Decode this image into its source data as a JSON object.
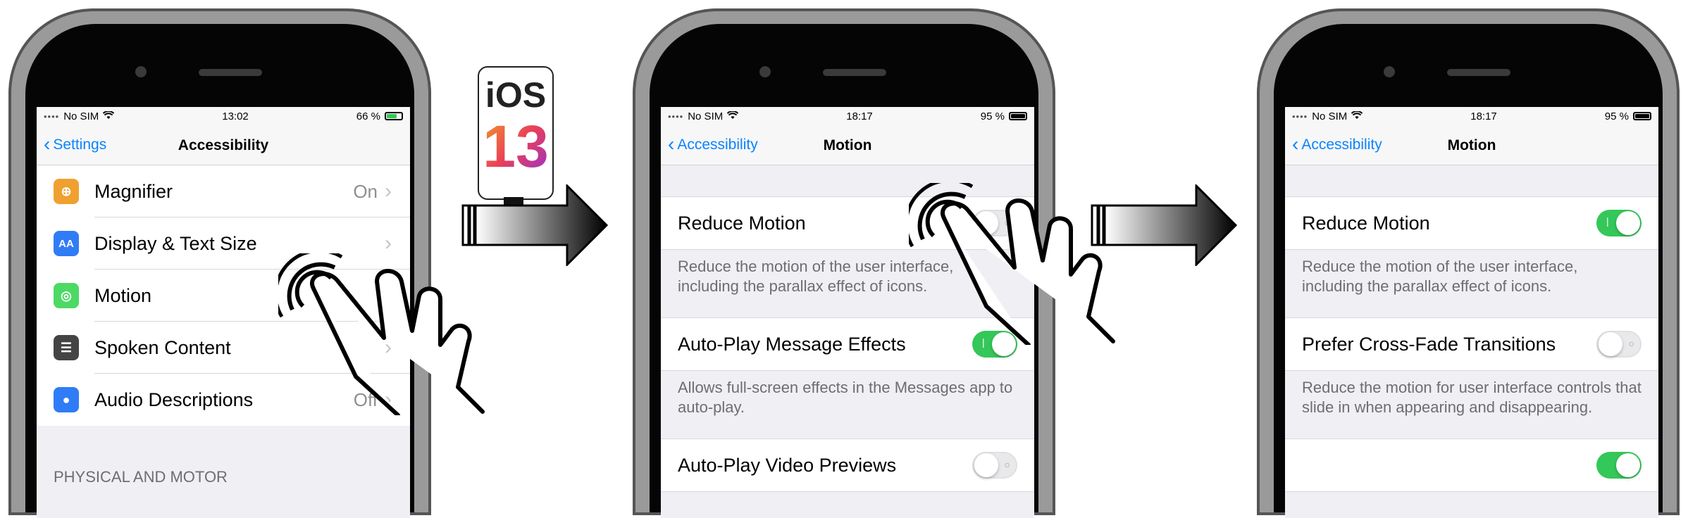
{
  "badge": {
    "ios": "iOS",
    "version": "13"
  },
  "screens": [
    {
      "status": {
        "carrier": "No SIM",
        "time": "13:02",
        "battery": "66 %"
      },
      "nav": {
        "back": "Settings",
        "title": "Accessibility"
      },
      "rows": [
        {
          "label": "Magnifier",
          "value": "On",
          "icon": "magnifier-icon",
          "color": "#f0a030",
          "glyph": "⊕"
        },
        {
          "label": "Display & Text Size",
          "value": "",
          "icon": "display-text-icon",
          "color": "#2f7cf6",
          "glyph": "AA"
        },
        {
          "label": "Motion",
          "value": "",
          "icon": "motion-icon",
          "color": "#4cd964",
          "glyph": "◎"
        },
        {
          "label": "Spoken Content",
          "value": "",
          "icon": "spoken-content-icon",
          "color": "#444444",
          "glyph": "☰"
        },
        {
          "label": "Audio Descriptions",
          "value": "Off",
          "icon": "audio-descriptions-icon",
          "color": "#2f7cf6",
          "glyph": "●"
        }
      ],
      "section_header": "PHYSICAL AND MOTOR"
    },
    {
      "status": {
        "carrier": "No SIM",
        "time": "18:17",
        "battery": "95 %"
      },
      "nav": {
        "back": "Accessibility",
        "title": "Motion"
      },
      "items": [
        {
          "label": "Reduce Motion",
          "toggle": "off",
          "footer": "Reduce the motion of the user interface, including the parallax effect of icons."
        },
        {
          "label": "Auto-Play Message Effects",
          "toggle": "on",
          "footer": "Allows full-screen effects in the Messages app to auto-play."
        },
        {
          "label": "Auto-Play Video Previews",
          "toggle": "off",
          "footer": ""
        }
      ]
    },
    {
      "status": {
        "carrier": "No SIM",
        "time": "18:17",
        "battery": "95 %"
      },
      "nav": {
        "back": "Accessibility",
        "title": "Motion"
      },
      "items": [
        {
          "label": "Reduce Motion",
          "toggle": "on",
          "footer": "Reduce the motion of the user interface, including the parallax effect of icons."
        },
        {
          "label": "Prefer Cross-Fade Transitions",
          "toggle": "off",
          "footer": "Reduce the motion for user interface controls that slide in when appearing and disappearing."
        }
      ]
    }
  ]
}
